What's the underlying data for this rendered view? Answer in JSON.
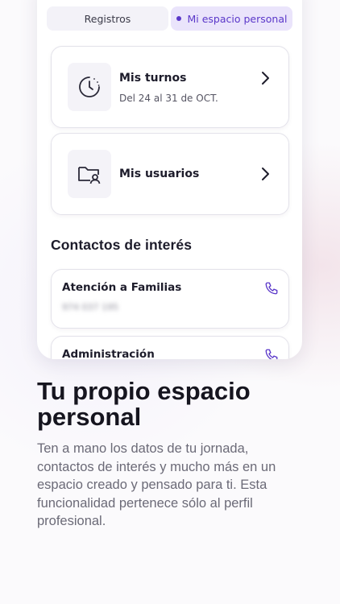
{
  "tabs": [
    {
      "label": "Registros",
      "active": false
    },
    {
      "label": "Mi espacio personal",
      "active": true
    }
  ],
  "cards": {
    "turnos": {
      "title": "Mis turnos",
      "subtitle": "Del 24 al 31 de OCT.",
      "icon": "clock-icon"
    },
    "usuarios": {
      "title": "Mis usuarios",
      "icon": "folder-user-icon"
    }
  },
  "contacts": {
    "title": "Contactos de interés",
    "items": [
      {
        "name": "Atención a Familias",
        "phone": "974 037 195",
        "icon": "phone-icon"
      },
      {
        "name": "Administración",
        "icon": "phone-icon"
      }
    ]
  },
  "promo": {
    "headline": "Tu propio espacio personal",
    "body": "Ten a mano los datos de tu jornada, contactos de interés y mucho más en un espacio creado y pensado para ti. Esta funcionalidad pertenece sólo al perfil profesional."
  },
  "colors": {
    "accent": "#5a37c9",
    "active_tab_bg": "#eae4fb",
    "text_dark": "#1d1c2b",
    "text_muted": "#6b6a77"
  }
}
